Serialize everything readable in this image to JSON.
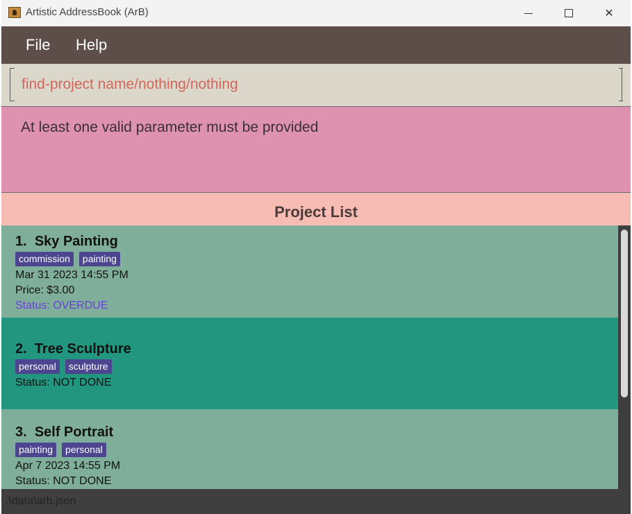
{
  "window": {
    "title": "Artistic AddressBook (ArB)",
    "icon": "address-book-icon"
  },
  "menu": {
    "items": [
      {
        "label": "File"
      },
      {
        "label": "Help"
      }
    ]
  },
  "command_box": {
    "value": "find-project name/nothing/nothing"
  },
  "result_display": {
    "message": "At least one valid parameter must be provided"
  },
  "project_list": {
    "title": "Project List",
    "projects": [
      {
        "index": "1.",
        "name": "Sky Painting",
        "tags": [
          "commission",
          "painting"
        ],
        "deadline": "Mar 31 2023 14:55 PM",
        "price": "Price: $3.00",
        "status": "Status: OVERDUE"
      },
      {
        "index": "2.",
        "name": "Tree Sculpture",
        "tags": [
          "personal",
          "sculpture"
        ],
        "status": "Status: NOT DONE"
      },
      {
        "index": "3.",
        "name": "Self Portrait",
        "tags": [
          "painting",
          "personal"
        ],
        "deadline": "Apr 7 2023 14:55 PM",
        "status": "Status: NOT DONE"
      }
    ]
  },
  "status_bar": {
    "path": ".\\data\\arb.json"
  },
  "colors": {
    "menu_bg": "#5d4e4a",
    "command_bg": "#dbd7cb",
    "command_text": "#d2665a",
    "result_bg": "#de92b0",
    "list_header_bg": "#f7bcb3",
    "card_bg": "#7fae9b",
    "card_selected_bg": "#22967f",
    "tag_bg": "#4d4590",
    "overdue_text": "#6b3ed8"
  }
}
